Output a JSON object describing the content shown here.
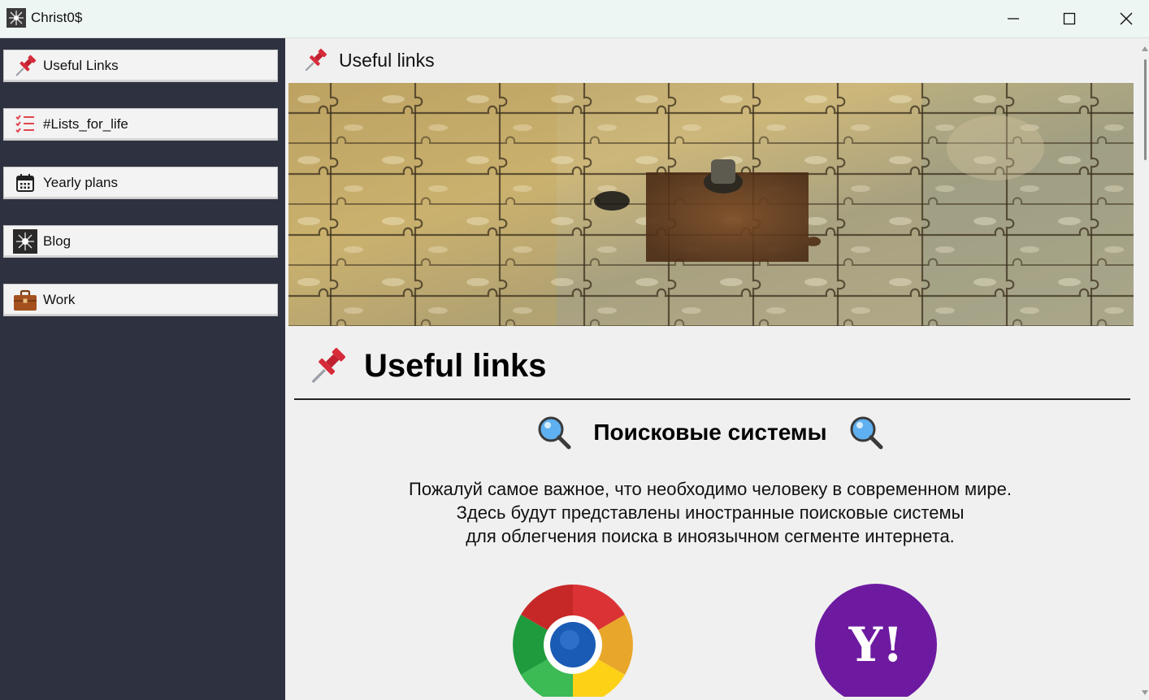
{
  "window": {
    "title": "Christ0$",
    "controls": [
      "minimize-icon",
      "maximize-icon",
      "close-icon"
    ]
  },
  "sidebar": {
    "items": [
      {
        "label": "Useful Links",
        "icon": "pushpin-icon"
      },
      {
        "label": "#Lists_for_life",
        "icon": "checklist-icon"
      },
      {
        "label": "Yearly plans",
        "icon": "calendar-icon"
      },
      {
        "label": "Blog",
        "icon": "blog-icon"
      },
      {
        "label": "Work",
        "icon": "briefcase-icon"
      }
    ]
  },
  "content": {
    "header_title": "Useful links",
    "banner": "puzzle-banner-image",
    "page_heading": "Useful links",
    "section_title": "Поисковые системы",
    "description": [
      "Пожалуй самое важное, что необходимо человеку в современном мире.",
      "Здесь будут представлены иностранные поисковые системы",
      "для облегчения поиска в иноязычном сегменте интернета."
    ],
    "engines": [
      {
        "name": "chrome-logo",
        "icon": "chrome-icon"
      },
      {
        "name": "yahoo-logo",
        "icon": "yahoo-icon",
        "logo_text": "Y!"
      }
    ]
  },
  "colors": {
    "sidebar_bg": "#2e3240",
    "content_bg": "#f0f0f0",
    "titlebar_bg": "#eef6f3",
    "yahoo_purple": "#6d1aa0",
    "pin_red": "#d62b3a"
  }
}
